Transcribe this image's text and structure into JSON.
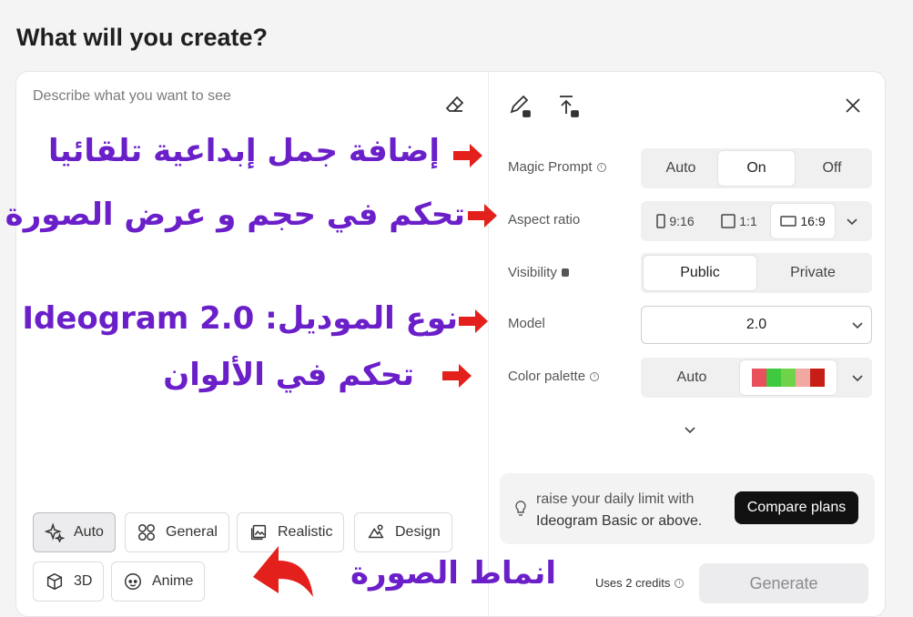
{
  "page": {
    "title": "What will you create?"
  },
  "prompt": {
    "placeholder": "Describe what you want to see"
  },
  "styles": [
    {
      "label": "Auto",
      "active": true
    },
    {
      "label": "General"
    },
    {
      "label": "Realistic"
    },
    {
      "label": "Design"
    },
    {
      "label": "3D"
    },
    {
      "label": "Anime"
    }
  ],
  "settings": {
    "magic_prompt": {
      "label": "Magic Prompt",
      "options": [
        "Auto",
        "On",
        "Off"
      ],
      "selected": "On"
    },
    "aspect_ratio": {
      "label": "Aspect ratio",
      "options": [
        "9:16",
        "1:1",
        "16:9"
      ],
      "selected": "16:9"
    },
    "visibility": {
      "label": "Visibility",
      "options": [
        "Public",
        "Private"
      ],
      "selected": "Public"
    },
    "model": {
      "label": "Model",
      "value": "2.0"
    },
    "color_palette": {
      "label": "Color palette",
      "value": "Auto",
      "swatches": [
        "#e8505b",
        "#3ec93e",
        "#6fd34a",
        "#f0a9a0",
        "#c61e16"
      ]
    }
  },
  "tip": {
    "line1": "raise your daily limit with",
    "line2": "Ideogram Basic or above.",
    "button": "Compare plans"
  },
  "footer": {
    "credits": "Uses 2 credits",
    "generate": "Generate"
  },
  "annotations": {
    "magic": "إضافة جمل إبداعية تلقائيا",
    "aspect": "تحكم في حجم و عرض الصورة",
    "model": "نوع الموديل: Ideogram 2.0",
    "colors": "تحكم في الألوان",
    "styles": "انماط الصورة"
  },
  "colors": {
    "annotation": "#6a1fc9",
    "arrow": "#e3201b"
  }
}
